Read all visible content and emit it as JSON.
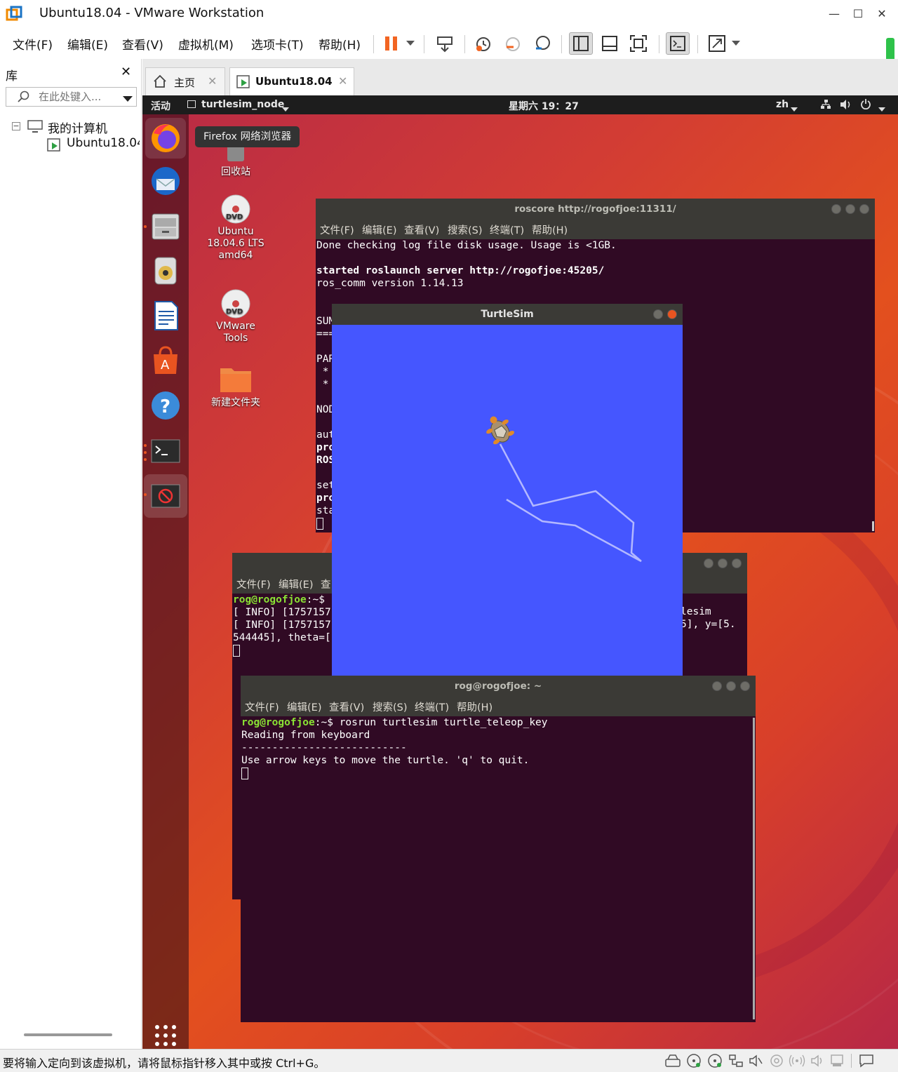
{
  "window": {
    "title": "Ubuntu18.04 - VMware Workstation"
  },
  "menubar": {
    "items": [
      "文件(F)",
      "编辑(E)",
      "查看(V)",
      "虚拟机(M)",
      "选项卡(T)",
      "帮助(H)"
    ]
  },
  "toolbar": {
    "icons": [
      "pause-icon",
      "dropdown-icon",
      "send-ctrl-alt-del-icon",
      "snapshot-icon",
      "revert-snapshot-icon",
      "snapshot-manager-icon",
      "sidebar-view-icon",
      "single-window-icon",
      "fullscreen-icon",
      "console-view-icon",
      "stretch-icon",
      "dropdown-icon"
    ]
  },
  "library": {
    "title": "库",
    "search_placeholder": "在此处键入...",
    "tree": {
      "root": "我的计算机",
      "child": "Ubuntu18.04"
    }
  },
  "vm_tabs": [
    {
      "label": "主页",
      "active": false
    },
    {
      "label": "Ubuntu18.04",
      "active": true
    }
  ],
  "ubuntu": {
    "topbar": {
      "activities": "活动",
      "app_menu": "turtlesim_node",
      "clock": "星期六 19：27",
      "input_method": "zh"
    },
    "dock_tooltip": "Firefox 网络浏览器",
    "desktop_icons": [
      {
        "label": "回收站",
        "icon": "trash-icon"
      },
      {
        "label": "Ubuntu 18.04.6 LTS amd64",
        "icon": "dvd-icon"
      },
      {
        "label": "VMware Tools",
        "icon": "dvd-icon"
      },
      {
        "label": "新建文件夹",
        "icon": "folder-icon"
      }
    ],
    "terminal_menu": [
      "文件(F)",
      "编辑(E)",
      "查看(V)",
      "搜索(S)",
      "终端(T)",
      "帮助(H)"
    ],
    "roscore_terminal": {
      "title": "roscore http://rogofjoe:11311/",
      "lines": [
        "Done checking log file disk usage. Usage is <1GB.",
        "",
        "started roslaunch server http://rogofjoe:45205/",
        "ros_comm version 1.14.13",
        "",
        "",
        "SUM",
        "===",
        "",
        "PAR",
        " *",
        " *",
        "",
        "NOD",
        "",
        "aut",
        "pro",
        "ROS",
        "",
        "set",
        "pro",
        "sta"
      ]
    },
    "middle_terminal": {
      "menu_partial": [
        "文件(F)",
        "编辑(E)",
        "查"
      ],
      "prompt_user": "rog@rogofjoe",
      "prompt_path": ":~$",
      "line1_left": "[ INFO] [1757157",
      "line1_right": "lesim",
      "line2_left": "[ INFO] [1757157",
      "line2_right": "5], y=[5.",
      "line3_left": "544445], theta=["
    },
    "teleop_terminal": {
      "title": "rog@rogofjoe: ~",
      "prompt_user": "rog@rogofjoe",
      "prompt_path": ":~$",
      "command": " rosrun turtlesim turtle_teleop_key",
      "line1": "Reading from keyboard",
      "line2": "---------------------------",
      "line3": "Use arrow keys to move the turtle. 'q' to quit."
    },
    "turtlesim": {
      "title": "TurtleSim",
      "background": "#4556ff",
      "path_color": "#b3b8ff"
    }
  },
  "statusbar": {
    "message": "要将输入定向到该虚拟机，请将鼠标指针移入其中或按 Ctrl+G。"
  },
  "colors": {
    "accent_orange": "#e95420",
    "terminal_bg": "#300a24",
    "prompt_green": "#8ae234"
  }
}
